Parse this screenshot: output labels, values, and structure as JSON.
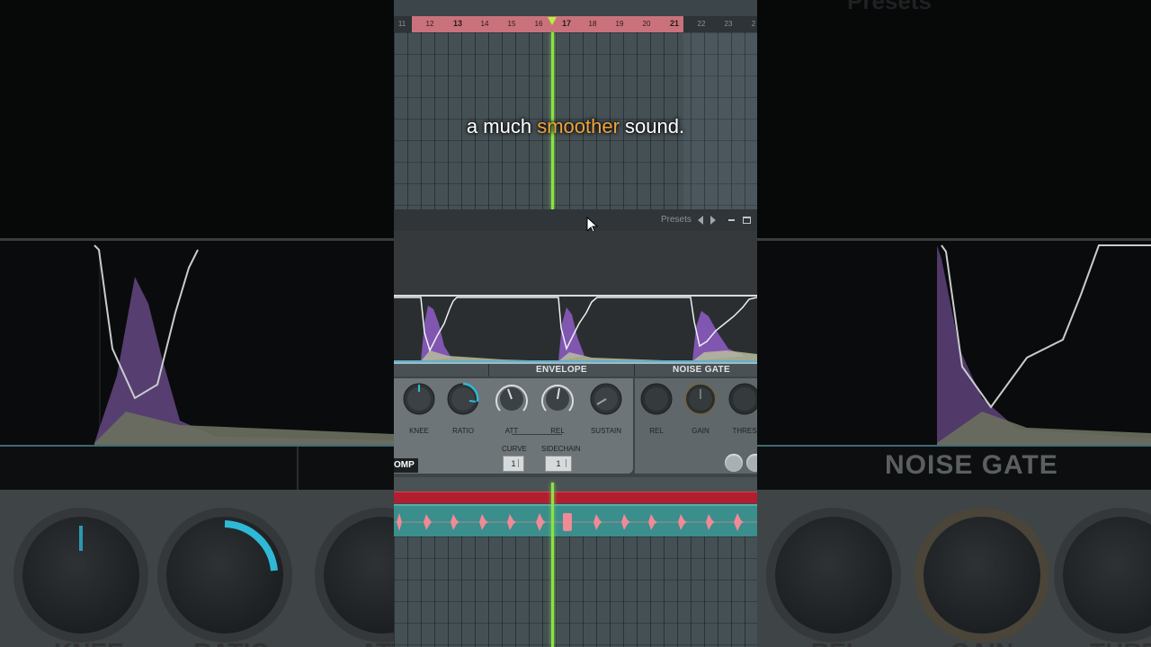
{
  "caption": {
    "before": "a much",
    "highlight": "smoother",
    "after": "sound."
  },
  "ruler": {
    "bars": [
      "11",
      "12",
      "13",
      "14",
      "15",
      "16",
      "17",
      "18",
      "19",
      "20",
      "21",
      "22",
      "23",
      "2"
    ]
  },
  "plugin": {
    "presets_label": "Presets",
    "sections": {
      "envelope": "ENVELOPE",
      "noise_gate": "NOISE GATE"
    },
    "knobs": {
      "knee": "KNEE",
      "ratio": "RATIO",
      "att": "ATT",
      "rel": "REL",
      "sustain": "SUSTAIN",
      "gate_rel": "REL",
      "gain": "GAIN",
      "thres": "THRES"
    },
    "curve_label": "CURVE",
    "curve_value": "1",
    "sidechain_label": "SIDECHAIN",
    "sidechain_value": "1",
    "comp_tab": "OMP"
  },
  "background_blur": {
    "noise_gate": "NOISE GATE",
    "presets": "Presets",
    "labels": [
      "KNEE",
      "RATIO",
      "ATT",
      "REL",
      "GAIN",
      "THRES"
    ]
  },
  "colors": {
    "accent_caption": "#f0a33d",
    "playhead": "#8be14a",
    "loop_region": "#c9727c",
    "pattern": "#3a8e8c",
    "pattern_notes": "#f08a96",
    "ratio_arc": "#2fb9d6"
  }
}
